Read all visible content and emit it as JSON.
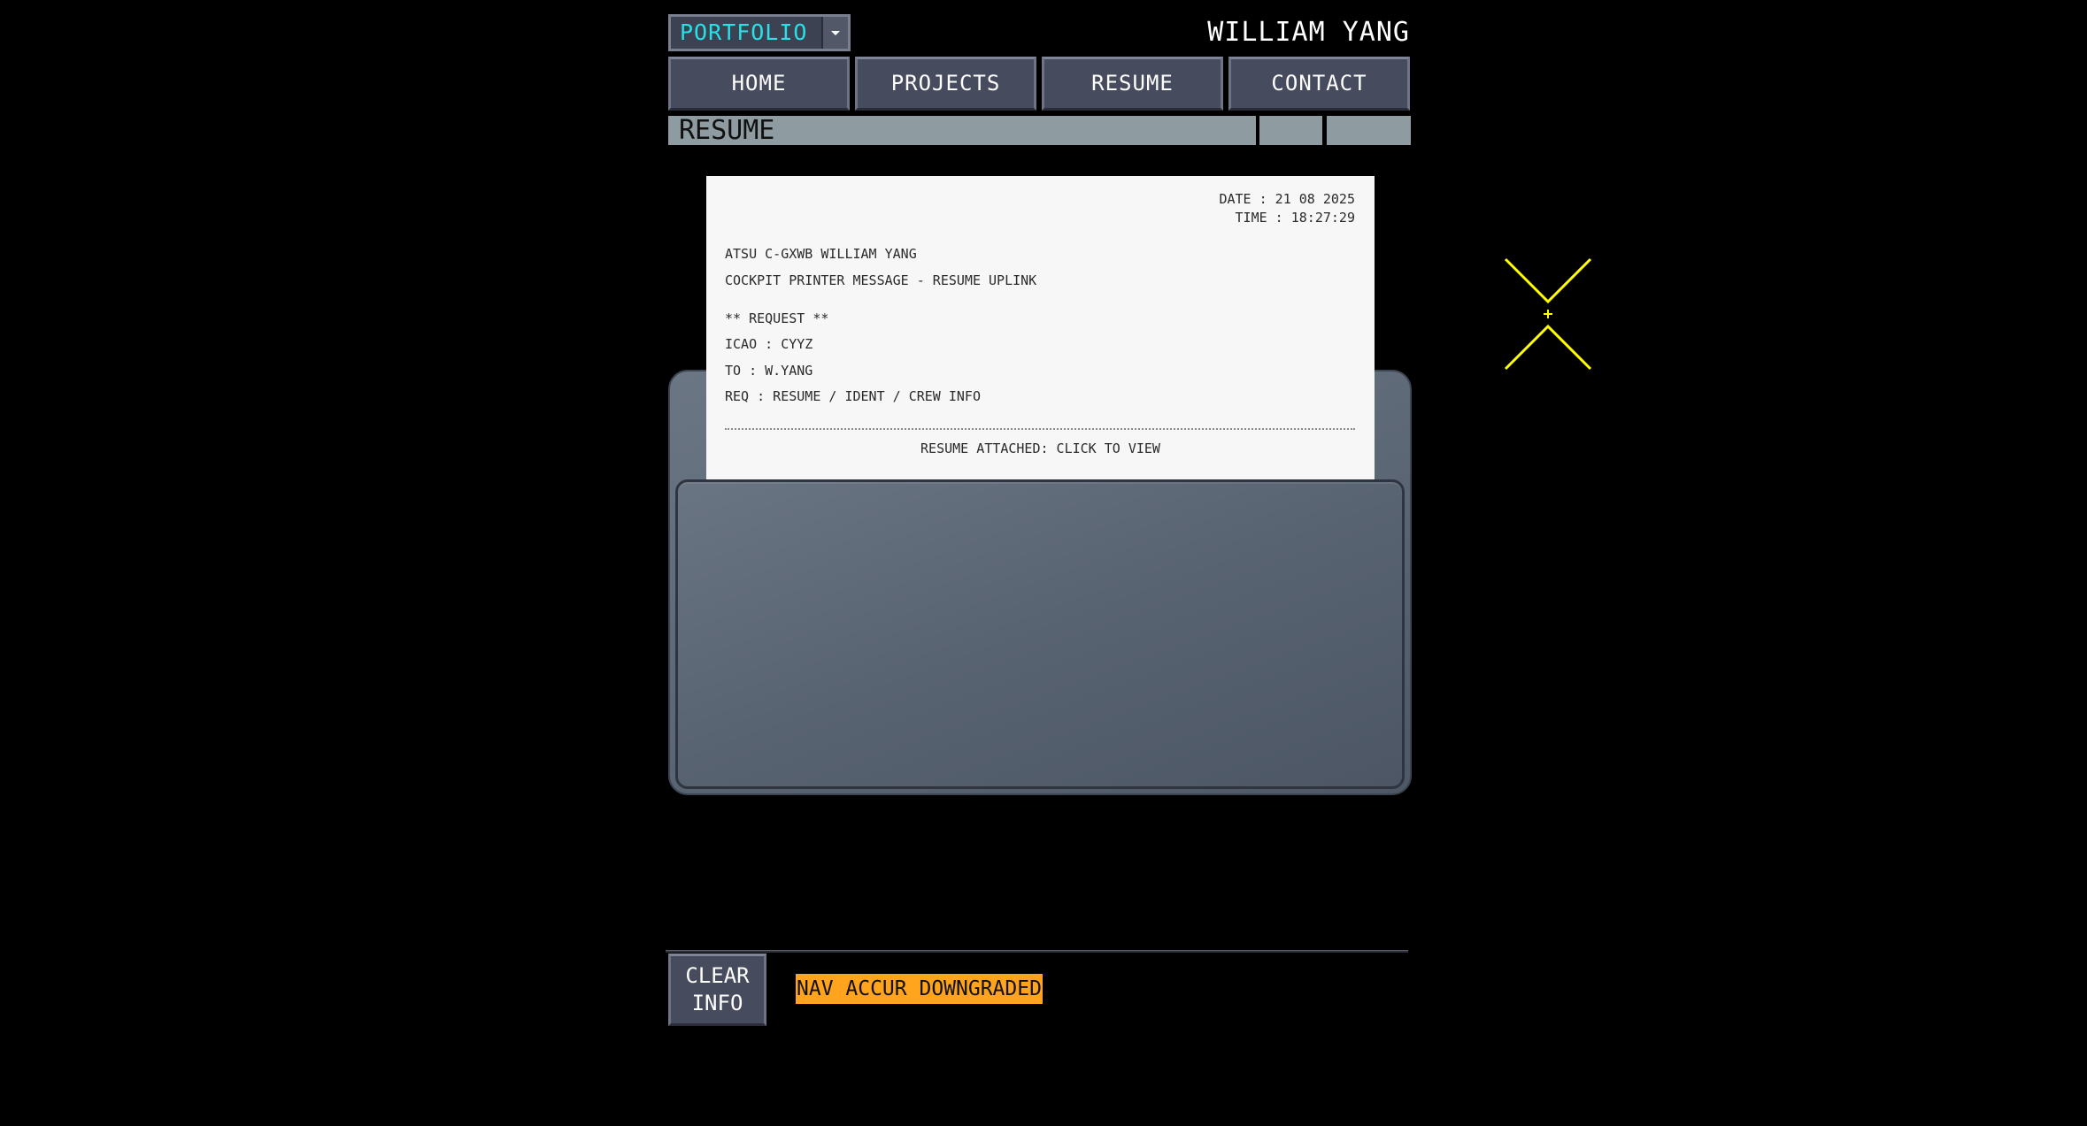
{
  "header": {
    "dropdown": {
      "selected": "PORTFOLIO",
      "icon": "caret-down-icon"
    },
    "owner_name": "WILLIAM YANG"
  },
  "nav": {
    "items": [
      {
        "label": "HOME"
      },
      {
        "label": "PROJECTS"
      },
      {
        "label": "RESUME"
      },
      {
        "label": "CONTACT"
      }
    ]
  },
  "title_strip": {
    "title": "RESUME"
  },
  "printout": {
    "date": "DATE : 21 08 2025",
    "time": "TIME : 18:27:29",
    "line1": "ATSU C-GXWB WILLIAM YANG",
    "line2": "COCKPIT PRINTER MESSAGE - RESUME UPLINK",
    "request_header": "** REQUEST **",
    "icao": "ICAO : CYYZ",
    "to": "TO : W.YANG",
    "req": "REQ : RESUME / IDENT / CREW INFO",
    "attachment": "RESUME ATTACHED: CLICK TO VIEW"
  },
  "footer": {
    "clear_line1": "CLEAR",
    "clear_line2": "INFO",
    "alert": "NAV ACCUR DOWNGRADED"
  },
  "colors": {
    "background": "#000000",
    "accent_cyan": "#27e0e8",
    "button_fill": "#474b5e",
    "title_strip": "#8e9ba1",
    "target_yellow": "#ffff00",
    "alert_amber": "#ffa41c"
  }
}
